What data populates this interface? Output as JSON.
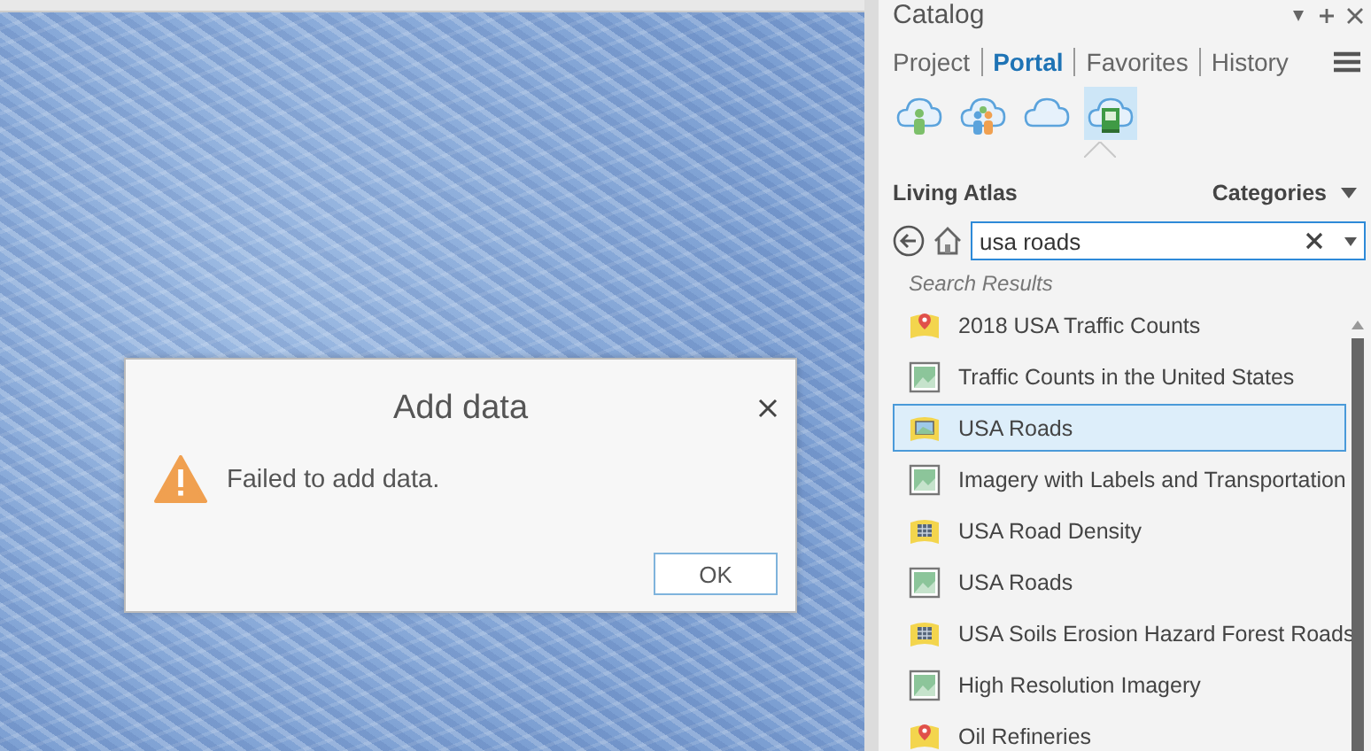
{
  "catalog": {
    "title": "Catalog",
    "tabs": [
      {
        "label": "Project",
        "selected": false
      },
      {
        "label": "Portal",
        "selected": true
      },
      {
        "label": "Favorites",
        "selected": false
      },
      {
        "label": "History",
        "selected": false
      }
    ],
    "sources": [
      {
        "kind": "my-content",
        "selected": false
      },
      {
        "kind": "groups",
        "selected": false
      },
      {
        "kind": "portal",
        "selected": false
      },
      {
        "kind": "living-atlas",
        "selected": true
      }
    ],
    "collection": "Living Atlas",
    "categories": "Categories",
    "search": {
      "value": "usa roads"
    },
    "results_heading": "Search Results",
    "results": [
      {
        "kind": "point-layer",
        "label": "2018 USA Traffic Counts",
        "selected": false
      },
      {
        "kind": "map-service",
        "label": "Traffic Counts in the United States",
        "selected": false
      },
      {
        "kind": "web-map",
        "label": "USA Roads",
        "selected": true
      },
      {
        "kind": "map-service",
        "label": "Imagery with Labels and Transportation",
        "selected": false
      },
      {
        "kind": "grid-layer",
        "label": "USA Road Density",
        "selected": false
      },
      {
        "kind": "map-service",
        "label": "USA Roads",
        "selected": false
      },
      {
        "kind": "grid-layer",
        "label": "USA Soils Erosion Hazard Forest Roads",
        "selected": false
      },
      {
        "kind": "map-service",
        "label": "High Resolution Imagery",
        "selected": false
      },
      {
        "kind": "point-layer",
        "label": "Oil Refineries",
        "selected": false
      }
    ]
  },
  "dialog": {
    "title": "Add data",
    "message": "Failed to add data.",
    "button": "OK"
  }
}
